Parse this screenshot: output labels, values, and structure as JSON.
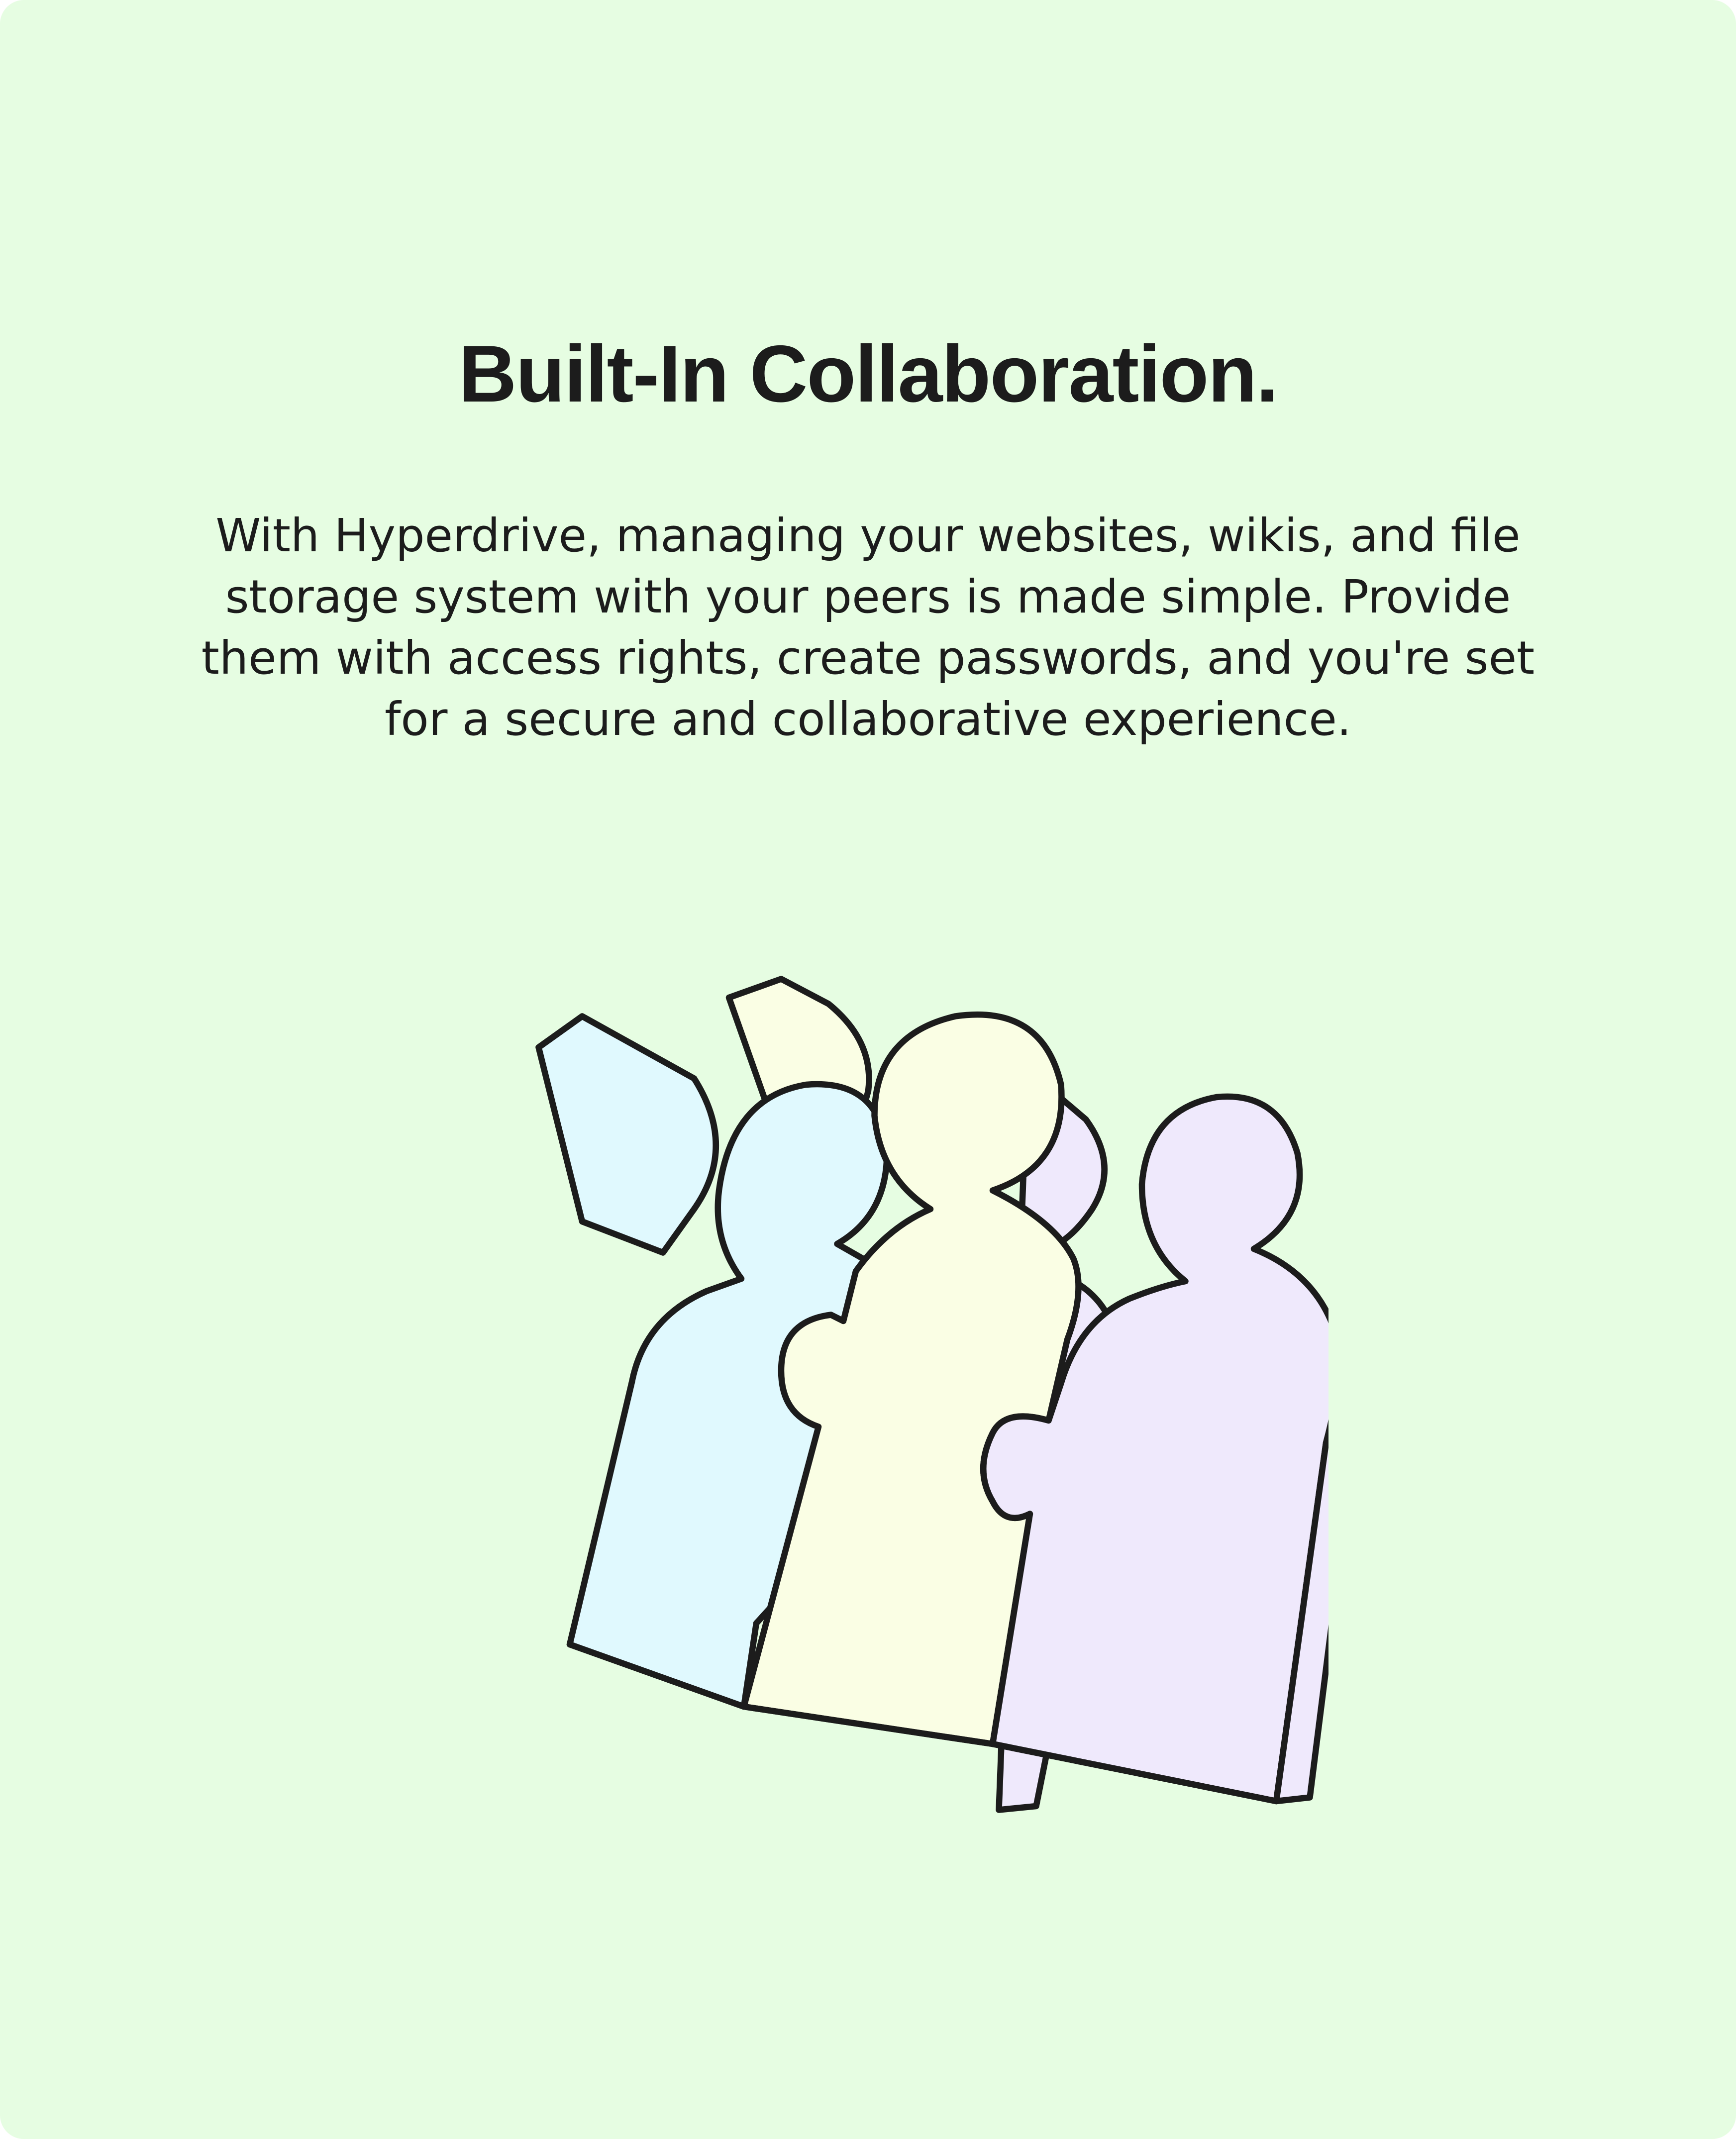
{
  "feature": {
    "title": "Built-In Collaboration.",
    "description": "With Hyperdrive, managing your websites, wikis, and file storage system with your peers is made simple. Provide them with access rights, create passwords, and you're set for a secure and collaborative experience."
  },
  "illustration": {
    "icon": "collaboration-people-puzzle-icon"
  },
  "colors": {
    "background": "#e6fde2",
    "text": "#1c1c1c",
    "outline": "#1c1c1c",
    "person_left": "#e0f9fe",
    "person_middle": "#fafee4",
    "person_right": "#efe9fc"
  }
}
